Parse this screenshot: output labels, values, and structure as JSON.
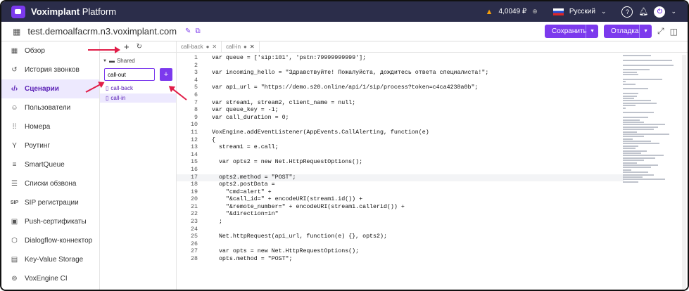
{
  "app": {
    "brand_bold": "Voximplant",
    "brand_rest": " Platform",
    "balance": "4,0049 ₽",
    "language": "Русский"
  },
  "subbar": {
    "domain": "test.demoalfacrm.n3.voximplant.com",
    "save": "Сохранить",
    "debug": "Отладка"
  },
  "sidebar": {
    "items": [
      {
        "label": "Обзор",
        "icon": "dashboard-icon"
      },
      {
        "label": "История звонков",
        "icon": "history-icon"
      },
      {
        "label": "Сценарии",
        "icon": "code-icon",
        "active": true
      },
      {
        "label": "Пользователи",
        "icon": "users-icon"
      },
      {
        "label": "Номера",
        "icon": "dialpad-icon"
      },
      {
        "label": "Роутинг",
        "icon": "routing-icon"
      },
      {
        "label": "SmartQueue",
        "icon": "queue-icon"
      },
      {
        "label": "Списки обзвона",
        "icon": "list-icon"
      },
      {
        "label": "SIP регистрации",
        "icon": "sip-icon"
      },
      {
        "label": "Push-сертификаты",
        "icon": "certificate-icon"
      },
      {
        "label": "Dialogflow-коннектор",
        "icon": "dialogflow-icon"
      },
      {
        "label": "Key-Value Storage",
        "icon": "storage-icon"
      },
      {
        "label": "VoxEngine CI",
        "icon": "ci-icon"
      }
    ]
  },
  "tree": {
    "folder": "Shared",
    "input_value": "call-out",
    "files": [
      "call-back",
      "call-in"
    ]
  },
  "tabs": [
    {
      "label": "call-back"
    },
    {
      "label": "call-in"
    }
  ],
  "code": {
    "lines": [
      "var queue = ['sip:101', 'pstn:79999999999'];",
      "",
      "var incoming_hello = \"Здравствуйте! Пожалуйста, дождитесь ответа специалиста!\";",
      "",
      "var api_url = \"https://demo.s20.online/api/1/sip/process?token=c4ca4238a0b\";",
      "",
      "var stream1, stream2, client_name = null;",
      "var queue_key = -1;",
      "var call_duration = 0;",
      "",
      "VoxEngine.addEventListener(AppEvents.CallAlerting, function(e)",
      "{",
      "  stream1 = e.call;",
      "",
      "  var opts2 = new Net.HttpRequestOptions();",
      "",
      "  opts2.method = \"POST\";",
      "  opts2.postData =",
      "    \"cmd=alert\" +",
      "    \"&call_id=\" + encodeURI(stream1.id()) +",
      "    \"&remote_number=\" + encodeURI(stream1.callerid()) +",
      "    \"&direction=in\"",
      "  ;",
      "",
      "  Net.httpRequest(api_url, function(e) {}, opts2);",
      "",
      "  var opts = new Net.HttpRequestOptions();",
      "  opts.method = \"POST\";"
    ]
  }
}
